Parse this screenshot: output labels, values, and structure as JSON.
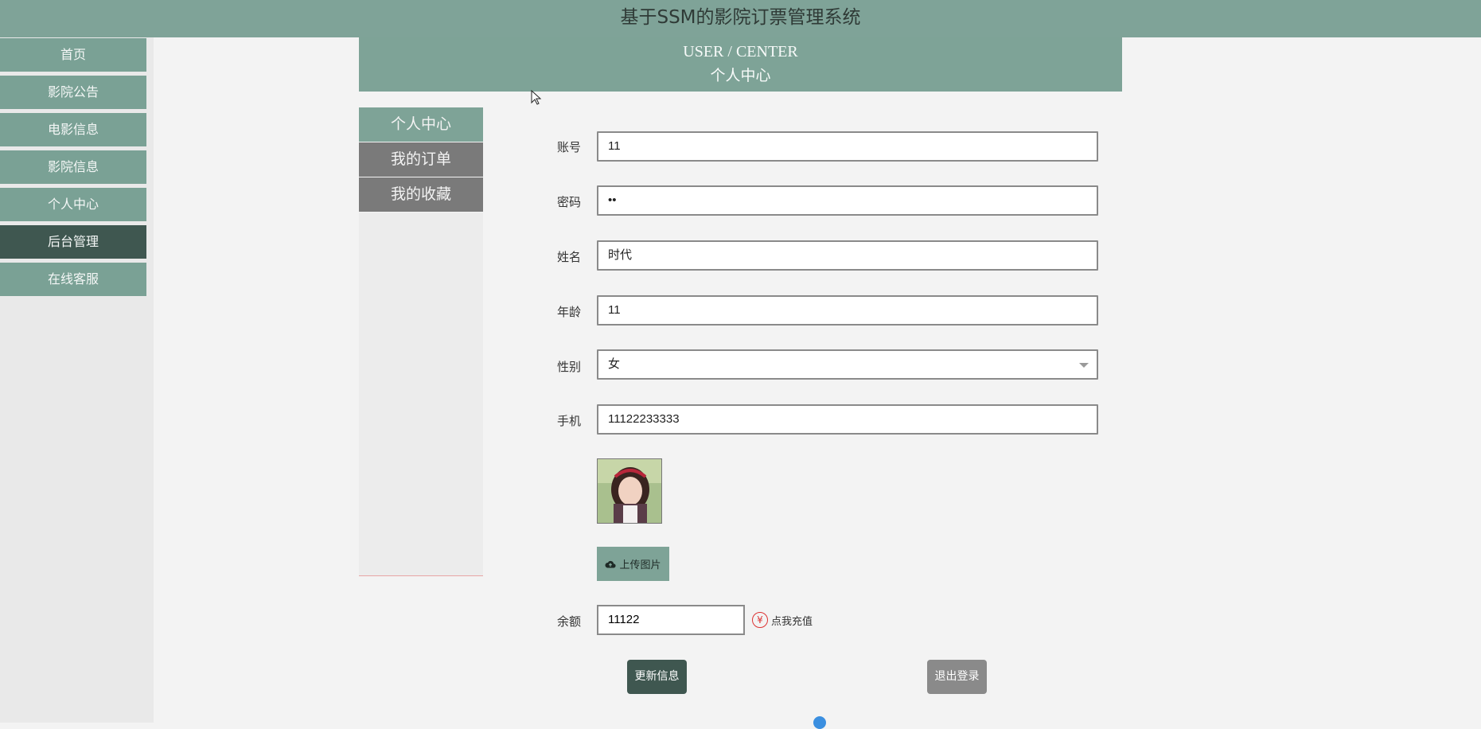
{
  "app": {
    "title": "基于SSM的影院订票管理系统"
  },
  "nav": {
    "items": [
      {
        "label": "首页"
      },
      {
        "label": "影院公告"
      },
      {
        "label": "电影信息"
      },
      {
        "label": "影院信息"
      },
      {
        "label": "个人中心"
      },
      {
        "label": "后台管理"
      },
      {
        "label": "在线客服"
      }
    ],
    "active_label": "后台管理"
  },
  "header": {
    "title_en": "USER / CENTER",
    "title_zh": "个人中心"
  },
  "submenu": {
    "items": [
      {
        "label": "个人中心"
      },
      {
        "label": "我的订单"
      },
      {
        "label": "我的收藏"
      }
    ],
    "active_label": "个人中心"
  },
  "form": {
    "account": {
      "label": "账号",
      "value": "11"
    },
    "password": {
      "label": "密码",
      "value": "••"
    },
    "name": {
      "label": "姓名",
      "value": "时代"
    },
    "age": {
      "label": "年龄",
      "value": "11"
    },
    "gender": {
      "label": "性别",
      "value": "女"
    },
    "phone": {
      "label": "手机",
      "value": "11122233333"
    },
    "upload_label": "上传图片",
    "balance": {
      "label": "余额",
      "value": "11122"
    },
    "recharge_label": "点我充值",
    "update_button": "更新信息",
    "logout_button": "退出登录"
  },
  "colors": {
    "accent": "#7ea397",
    "dark_accent": "#3f5750",
    "muted": "#7a7a7a"
  }
}
